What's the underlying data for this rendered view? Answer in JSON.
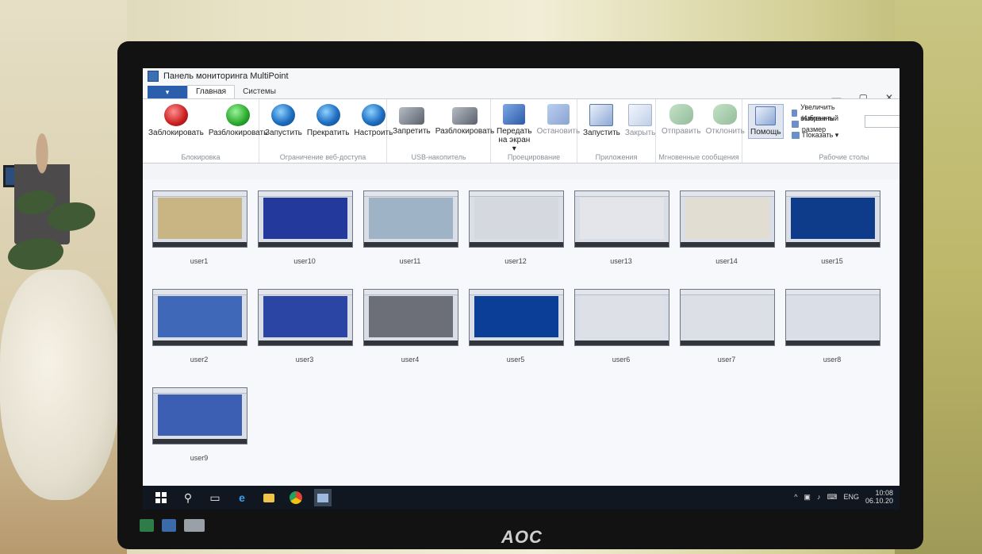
{
  "window": {
    "title": "Панель мониторинга MultiPoint",
    "controls": [
      "—",
      "▢",
      "✕"
    ]
  },
  "tabs": {
    "file": "▾",
    "main": "Главная",
    "systems": "Системы"
  },
  "ribbon": {
    "groups": [
      {
        "id": "lock",
        "label": "Блокировка",
        "buttons": [
          {
            "label": "Заблокировать",
            "icon": "stop-icon"
          },
          {
            "label": "Разблокировать",
            "icon": "arrow-up-icon"
          }
        ]
      },
      {
        "id": "web",
        "label": "Ограничение веб-доступа",
        "buttons": [
          {
            "label": "Запустить",
            "icon": "globe-icon"
          },
          {
            "label": "Прекратить",
            "icon": "globe-stop-icon"
          },
          {
            "label": "Настроить",
            "icon": "globe-settings-icon"
          }
        ]
      },
      {
        "id": "usb",
        "label": "USB-накопитель",
        "buttons": [
          {
            "label": "Запретить",
            "icon": "usb-block-icon"
          },
          {
            "label": "Разблокировать",
            "icon": "usb-unlock-icon"
          }
        ]
      },
      {
        "id": "proj",
        "label": "Проецирование",
        "buttons": [
          {
            "label": "Передать на экран ▾",
            "icon": "projector-icon"
          },
          {
            "label": "Остановить",
            "icon": "projector-stop-icon"
          }
        ]
      },
      {
        "id": "apps",
        "label": "Приложения",
        "buttons": [
          {
            "label": "Запустить",
            "icon": "app-run-icon"
          },
          {
            "label": "Закрыть",
            "icon": "app-close-icon"
          }
        ]
      },
      {
        "id": "msg",
        "label": "Мгновенные сообщения",
        "buttons": [
          {
            "label": "Отправить",
            "icon": "message-send-icon"
          },
          {
            "label": "Отклонить",
            "icon": "message-reject-icon"
          }
        ]
      }
    ],
    "help": "Помощь",
    "desktops": {
      "label": "Рабочие столы",
      "items": [
        "Увеличить выбранный",
        "Изменить размер",
        "Показать ▾"
      ]
    }
  },
  "thumbnails": [
    {
      "user": "user1",
      "theme": "#c9b583"
    },
    {
      "user": "user10",
      "theme": "#23399c"
    },
    {
      "user": "user11",
      "theme": "#9fb3c7"
    },
    {
      "user": "user12",
      "theme": "#d5d9df"
    },
    {
      "user": "user13",
      "theme": "#e3e5ea"
    },
    {
      "user": "user14",
      "theme": "#e2ddd3"
    },
    {
      "user": "user15",
      "theme": "#0e3c8a"
    },
    {
      "user": "user2",
      "theme": "#3f68b8"
    },
    {
      "user": "user3",
      "theme": "#2a45a3"
    },
    {
      "user": "user4",
      "theme": "#6c6f78"
    },
    {
      "user": "user5",
      "theme": "#0b3f97"
    },
    {
      "user": "user6",
      "theme": "#dde1e7"
    },
    {
      "user": "user7",
      "theme": "#dcdfe5"
    },
    {
      "user": "user8",
      "theme": "#dadfe7"
    },
    {
      "user": "user9",
      "theme": "#3d5fb3"
    }
  ],
  "taskbar": {
    "icons": [
      "windows-icon",
      "search-icon",
      "task-view-icon",
      "edge-icon",
      "explorer-icon",
      "chrome-icon",
      "multipoint-icon"
    ],
    "lang": "ENG",
    "time": "10:08",
    "date": "06.10.20"
  },
  "monitor": {
    "brand": "AOC"
  }
}
